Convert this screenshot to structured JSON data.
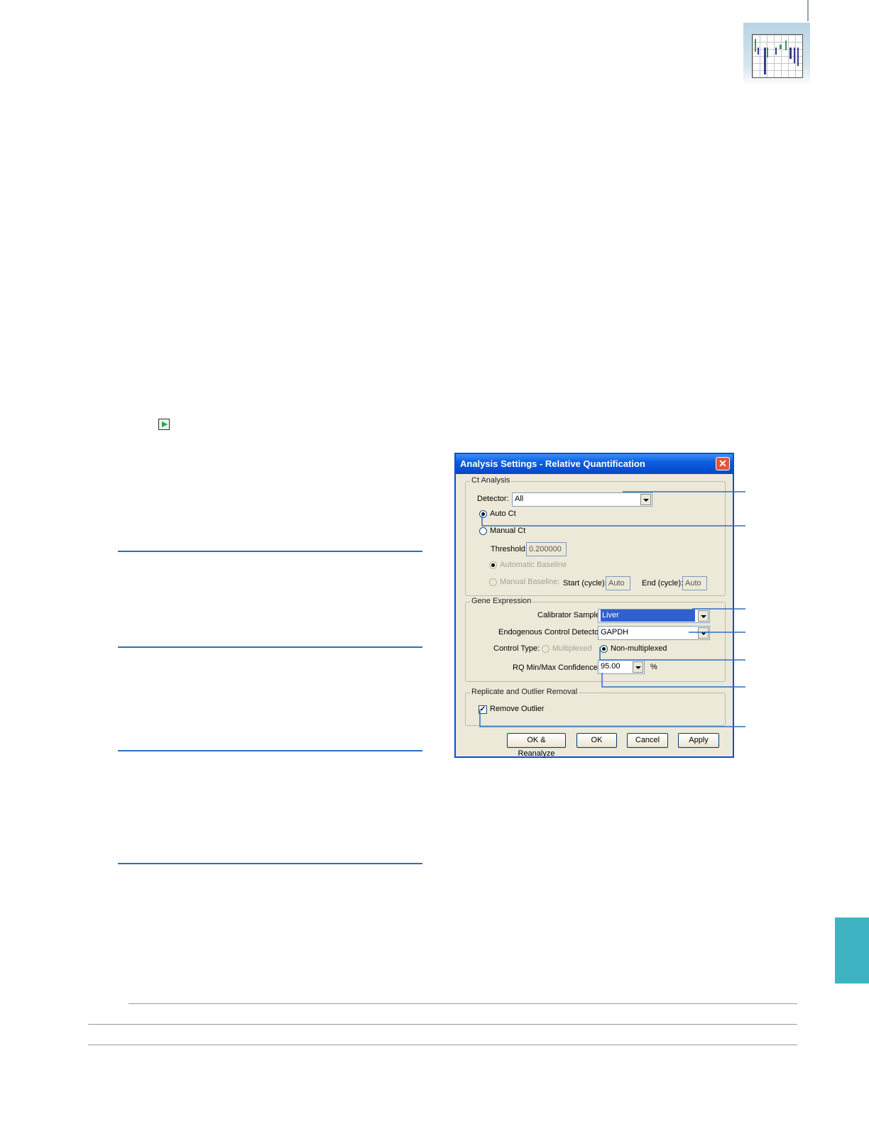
{
  "dialog": {
    "title": "Analysis Settings - Relative Quantification",
    "close_symbol": "✕",
    "ct_analysis": {
      "group_title": "Ct Analysis",
      "detector_label": "Detector:",
      "detector_value": "All",
      "auto_ct_label": "Auto Ct",
      "manual_ct_label": "Manual Ct",
      "threshold_label": "Threshold:",
      "threshold_value": "0.200000",
      "automatic_baseline_label": "Automatic Baseline",
      "manual_baseline_label": "Manual Baseline:",
      "start_cycle_label": "Start (cycle):",
      "start_cycle_value": "Auto",
      "end_cycle_label": "End (cycle):",
      "end_cycle_value": "Auto"
    },
    "gene_expression": {
      "group_title": "Gene Expression",
      "calibrator_label": "Calibrator Sample",
      "calibrator_value": "Liver",
      "endogenous_label": "Endogenous Control Detector",
      "endogenous_value": "GAPDH",
      "control_type_label": "Control Type:",
      "multiplexed_label": "Multiplexed",
      "non_multiplexed_label": "Non-multiplexed",
      "rq_label": "RQ Min/Max Confidence",
      "rq_value": "95.00",
      "percent": "%"
    },
    "replicate": {
      "group_title": "Replicate and Outlier Removal",
      "remove_outlier_label": "Remove Outlier",
      "check_mark": "✓"
    },
    "buttons": {
      "ok_reanalyze": "OK & Reanalyze",
      "ok": "OK",
      "cancel": "Cancel",
      "apply": "Apply"
    }
  },
  "colors": {
    "accent_rule": "#2e6fbf",
    "side_tab": "#3eb3c2",
    "titlebar": "#0a5fe0"
  }
}
